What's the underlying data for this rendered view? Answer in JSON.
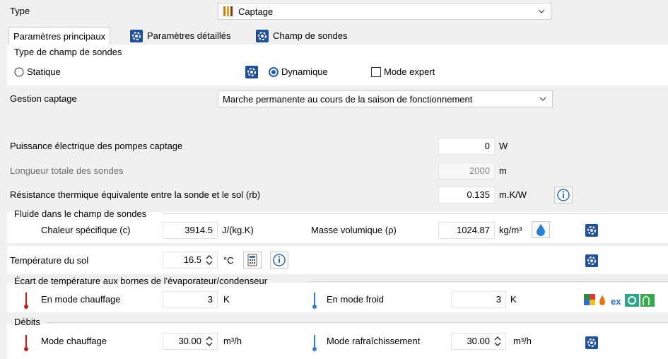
{
  "type": {
    "label": "Type",
    "value": "Captage"
  },
  "tabs": [
    {
      "label": "Paramètres principaux",
      "active": true
    },
    {
      "label": "Paramètres détaillés",
      "icon": "gear-icon"
    },
    {
      "label": "Champ de sondes",
      "icon": "gear-icon"
    }
  ],
  "type_champ": {
    "title": "Type de champ de sondes",
    "statique": "Statique",
    "dynamique": "Dynamique",
    "selected": "Dynamique",
    "mode_expert": "Mode expert"
  },
  "gestion": {
    "label": "Gestion captage",
    "value": "Marche permanente au cours de la saison de fonctionnement"
  },
  "puissance": {
    "label": "Puissance électrique des pompes captage",
    "value": "0",
    "unit": "W"
  },
  "longueur": {
    "label": "Longueur totale des sondes",
    "value": "2000",
    "unit": "m"
  },
  "resistance": {
    "label": "Résistance thermique équivalente entre la sonde et le sol (rb)",
    "value": "0.135",
    "unit": "m.K/W"
  },
  "fluide": {
    "title": "Fluide dans le champ de sondes",
    "chaleur_label": "Chaleur spécifique (c)",
    "chaleur_value": "3914.5",
    "chaleur_unit": "J/(kg.K)",
    "masse_label": "Masse volumique (ρ)",
    "masse_value": "1024.87",
    "masse_unit": "kg/m³"
  },
  "temp_sol": {
    "label": "Température du sol",
    "value": "16.5",
    "unit": "°C"
  },
  "ecart": {
    "title": "Écart de température aux bornes de l'évaporateur/condenseur",
    "chauffage_label": "En mode chauffage",
    "chauffage_value": "3",
    "chauffage_unit": "K",
    "froid_label": "En mode froid",
    "froid_value": "3",
    "froid_unit": "K"
  },
  "debits": {
    "title": "Débits",
    "chauffage_label": "Mode chauffage",
    "chauffage_value": "30.00",
    "chauffage_unit": "m³/h",
    "rafraichissement_label": "Mode rafraîchissement",
    "rafraichissement_value": "30.00",
    "rafraichissement_unit": "m³/h"
  },
  "colors": {
    "accent_blue": "#1f5fbf",
    "hot_red": "#d01818",
    "cold_blue": "#2a7fd4"
  }
}
